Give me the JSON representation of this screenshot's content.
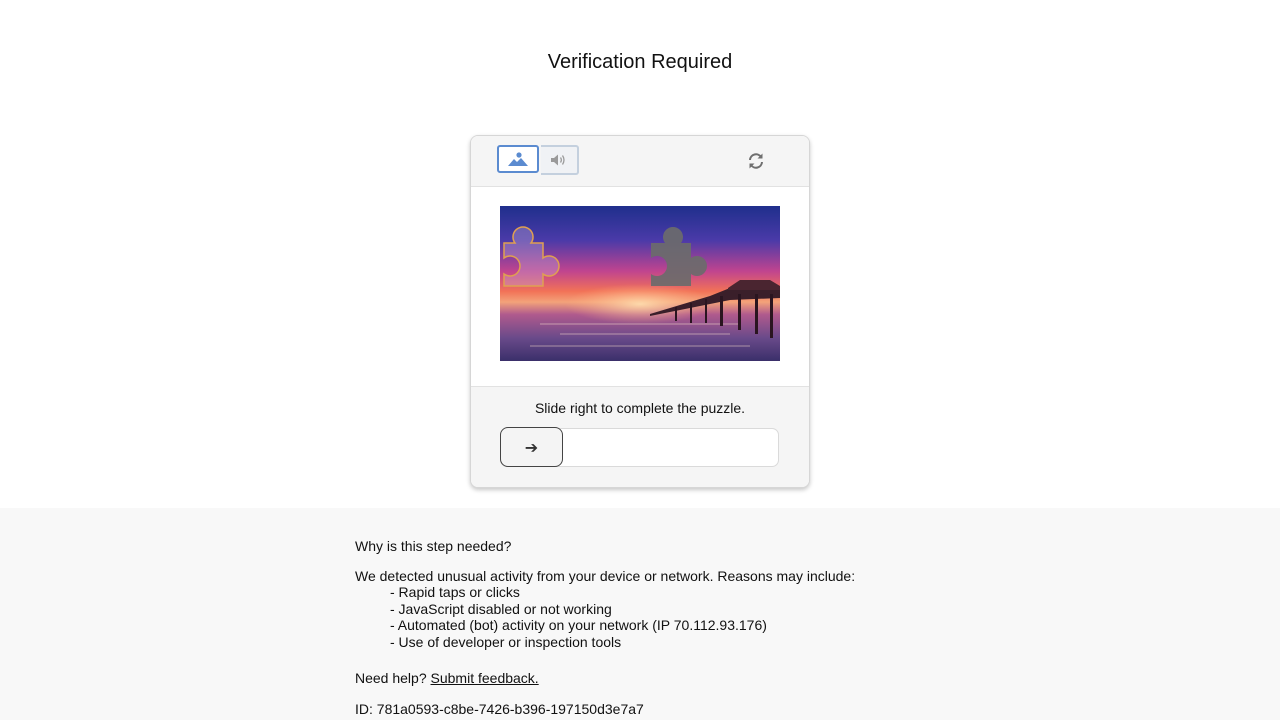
{
  "page": {
    "title": "Verification Required"
  },
  "captcha": {
    "mode_image_icon": "image-icon",
    "mode_audio_icon": "speaker-icon",
    "refresh_icon": "refresh-icon",
    "puzzle_image": "sunset-pier-photo",
    "instruction": "Slide right to complete the puzzle.",
    "slider_icon": "arrow-right-icon",
    "slider_arrow": "➔",
    "slider_progress": 0
  },
  "info": {
    "why_heading": "Why is this step needed?",
    "detected_text": "We detected unusual activity from your device or network. Reasons may include:",
    "reasons": [
      "- Rapid taps or clicks",
      "- JavaScript disabled or not working",
      "- Automated (bot) activity on your network (IP 70.112.93.176)",
      "- Use of developer or inspection tools"
    ],
    "help_prefix": "Need help?",
    "help_link": "Submit feedback.",
    "id_line": "ID: 781a0593-c8be-7426-b396-197150d3e7a7"
  },
  "colors": {
    "accent": "#5b8bd0",
    "piece_target": "#6b6b6b",
    "piece_outline": "#e0a050",
    "info_band": "#f8f8f8"
  }
}
